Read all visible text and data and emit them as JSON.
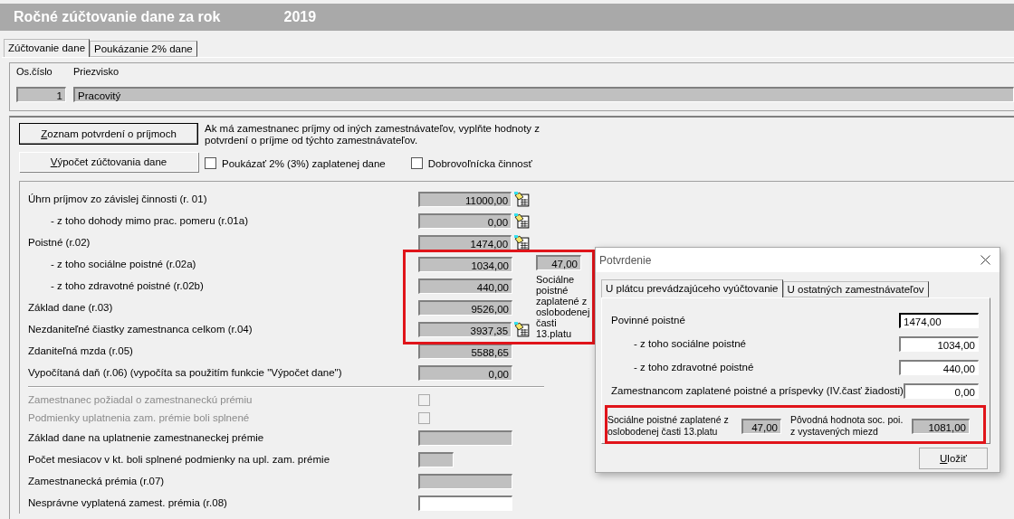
{
  "window": {
    "title": "Ročné zúčtovanie dane za rok",
    "year": "2019"
  },
  "tabs": [
    {
      "label": "Zúčtovanie dane",
      "selected": true
    },
    {
      "label": "Poukázanie 2% dane",
      "selected": false
    }
  ],
  "employee": {
    "number_label": "Os.číslo",
    "number": "1",
    "surname_label": "Priezvisko",
    "surname": "Pracovitý"
  },
  "actions": {
    "buttons": [
      {
        "label": "Zoznam potvrdení o príjmoch",
        "focused": true
      },
      {
        "label": "Výpočet zúčtovania dane",
        "focused": false
      }
    ],
    "hint": "Ak má zamestnanec príjmy od iných zamestnávateľov, vyplňte hodnoty z potvrdení o príjme od týchto zamestnávateľov.",
    "options": [
      {
        "label": "Poukázať 2% (3%) zaplatenej dane",
        "checked": false
      },
      {
        "label": "Dobrovoľnícka činnosť",
        "checked": false
      }
    ]
  },
  "rows": [
    {
      "kind": "field",
      "label": "Úhrn príjmov zo závislej činnosti (r. 01)",
      "indented": false,
      "value": "11000,00",
      "note_icon": true
    },
    {
      "kind": "field",
      "label": "- z toho dohody mimo prac. pomeru (r.01a)",
      "indented": true,
      "value": "0,00",
      "note_icon": true
    },
    {
      "kind": "field",
      "label": "Poistné (r.02)",
      "indented": false,
      "value": "1474,00",
      "note_icon": true
    },
    {
      "kind": "field",
      "label": "- z toho sociálne poistné (r.02a)",
      "indented": true,
      "value": "1034,00",
      "note_icon": false
    },
    {
      "kind": "field",
      "label": "- z toho zdravotné  poistné (r.02b)",
      "indented": true,
      "value": "440,00",
      "note_icon": false
    },
    {
      "kind": "field",
      "label": "Základ dane (r.03)",
      "indented": false,
      "value": "9526,00",
      "note_icon": false
    },
    {
      "kind": "field",
      "label": "Nezdaniteľné čiastky zamestnanca celkom (r.04)",
      "indented": false,
      "value": "3937,35",
      "note_icon": true
    },
    {
      "kind": "field",
      "label": "Zdaniteľná mzda (r.05)",
      "indented": false,
      "value": "5588,65",
      "note_icon": false
    },
    {
      "kind": "field",
      "label": "Vypočítaná daň (r.06)  (vypočíta sa použitím funkcie \"Výpočet dane\")",
      "indented": false,
      "value": "0,00",
      "note_icon": false
    },
    {
      "kind": "separator"
    },
    {
      "kind": "check",
      "label": "Zamestnanec požiadal o zamestnaneckú prémiu",
      "disabled": true,
      "checked": false
    },
    {
      "kind": "check",
      "label": "Podmienky uplatnenia zam. prémie boli splnené",
      "disabled": true,
      "checked": false
    },
    {
      "kind": "field",
      "label": "Základ dane na uplatnenie zamestnaneckej prémie",
      "indented": false,
      "note_icon": false
    },
    {
      "kind": "short_field",
      "label": "Počet mesiacov v kt. boli splnené podmienky na upl. zam. prémie",
      "indented": false,
      "note_icon": false
    },
    {
      "kind": "field",
      "label": "Zamestnanecká prémia (r.07)",
      "indented": false,
      "note_icon": false
    },
    {
      "kind": "entry",
      "label": "Nesprávne vyplatená zamest. prémia (r.08)",
      "indented": false,
      "note_icon": false
    }
  ],
  "side_note": {
    "value": "47,00",
    "text": "Sociálne poistné zaplatené z oslobodenej časti 13.platu"
  },
  "dialog": {
    "title": "Potvrdenie",
    "tabs": [
      {
        "label": "U plátcu prevádzajúceho vyúčtovanie",
        "selected": true
      },
      {
        "label": "U ostatných zamestnávateľov",
        "selected": false
      }
    ],
    "fields": [
      {
        "label": "Povinné poistné",
        "indented": false,
        "value": "1474,00",
        "focused": true
      },
      {
        "label": "- z toho sociálne poistné",
        "indented": true,
        "value": "1034,00",
        "focused": false
      },
      {
        "label": "- z toho zdravotné  poistné",
        "indented": true,
        "value": "440,00",
        "focused": false
      },
      {
        "label": "Zamestnancom zaplatené poistné a príspevky (IV.časť žiadosti)",
        "indented": false,
        "value": "0,00",
        "focused": false
      }
    ],
    "summary": [
      {
        "label": "Sociálne poistné zaplatené z oslobodenej časti 13.platu",
        "value": "47,00"
      },
      {
        "label": "Pôvodná hodnota soc. poi. z vystavených miezd",
        "value": "1081,00"
      }
    ],
    "button": "Uložiť"
  }
}
